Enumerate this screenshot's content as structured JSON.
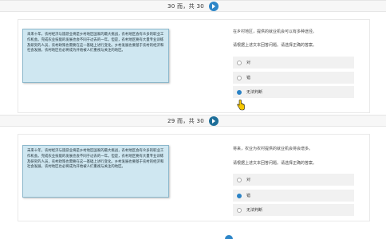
{
  "question_1": {
    "pager_text": "30 而，共 30",
    "passage": "未来十年，农村经济与旅游业将是乡村地区国家的最大挑战，农村地区会有众多的职业工作机会。完成农业技能的发展也会不同于过去的一年。但是，农村地区要有大量专业训练及研究的人员，农村政策也需要在这一基础上进行变化。乡村发展也要基于农村的经济和社会发展，农村地区也必将成为开始被人们重视与关注的地区。",
    "question": "在乡村地区，提供的就业机会可以有多种途径。",
    "instruction": "请根据上述文本回答问题。请选择正确的答案。",
    "options": [
      {
        "label": "对",
        "selected": false
      },
      {
        "label": "错",
        "selected": false
      },
      {
        "label": "无法判断",
        "selected": true
      }
    ]
  },
  "question_2": {
    "pager_text": "29 而，共 30",
    "passage": "未来十年，农村经济与旅游业将是乡村地区国家的最大挑战，农村地区会有众多的职业工作机会。完成农业技能的发展也会不同于过去的一年。但是，农村地区要有大量专业训练及研究的人员，农村政策也需要在这一基础上进行变化。乡村发展也要基于农村的经济和社会发展，农村地区也必将成为开始被人们重视与关注的地区。",
    "question": "将来，农业为农村提供的就业机会将会增多。",
    "instruction": "请根据上述文本回答问题。请选择正确的答案。",
    "options": [
      {
        "label": "对",
        "selected": false
      },
      {
        "label": "错",
        "selected": true
      },
      {
        "label": "无法判断",
        "selected": false
      }
    ]
  },
  "colors": {
    "accent": "#2d86c8",
    "passage_bg": "#cfe7f1",
    "passage_border": "#8bb7cb",
    "option_bg": "#f1f1f1"
  },
  "icons": [
    "next-arrow-icon",
    "radio-icon",
    "hand-cursor-icon"
  ]
}
